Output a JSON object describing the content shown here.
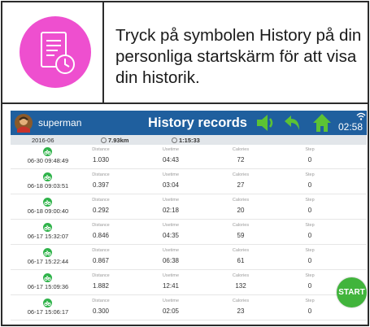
{
  "intro": {
    "icon": "history-document-clock-icon",
    "text": "Tryck på symbolen History på din personliga startskärm för att visa din historik."
  },
  "app": {
    "username": "superman",
    "title": "History records",
    "time": "02:58",
    "icons": [
      "volume-icon",
      "back-arrow-icon",
      "home-icon",
      "wifi-icon"
    ],
    "accent": "#1f5f9e",
    "icon_green": "#5cc234"
  },
  "summary": {
    "month": "2016-06",
    "total_distance": "7.93km",
    "total_time": "1:15:33"
  },
  "columns": {
    "distance": "Distance",
    "usetime": "Usetime",
    "calories": "Calories",
    "step": "Step"
  },
  "records": [
    {
      "datetime": "06-30 09:48:49",
      "distance": "1.030",
      "usetime": "04:43",
      "calories": "72",
      "step": "0"
    },
    {
      "datetime": "06-18 09:03:51",
      "distance": "0.397",
      "usetime": "03:04",
      "calories": "27",
      "step": "0"
    },
    {
      "datetime": "06-18 09:00:40",
      "distance": "0.292",
      "usetime": "02:18",
      "calories": "20",
      "step": "0"
    },
    {
      "datetime": "06-17 15:32:07",
      "distance": "0.846",
      "usetime": "04:35",
      "calories": "59",
      "step": "0"
    },
    {
      "datetime": "06-17 15:22:44",
      "distance": "0.867",
      "usetime": "06:38",
      "calories": "61",
      "step": "0"
    },
    {
      "datetime": "06-17 15:09:36",
      "distance": "1.882",
      "usetime": "12:41",
      "calories": "132",
      "step": "0"
    },
    {
      "datetime": "06-17 15:06:17",
      "distance": "0.300",
      "usetime": "02:05",
      "calories": "23",
      "step": "0"
    }
  ],
  "start_label": "START"
}
